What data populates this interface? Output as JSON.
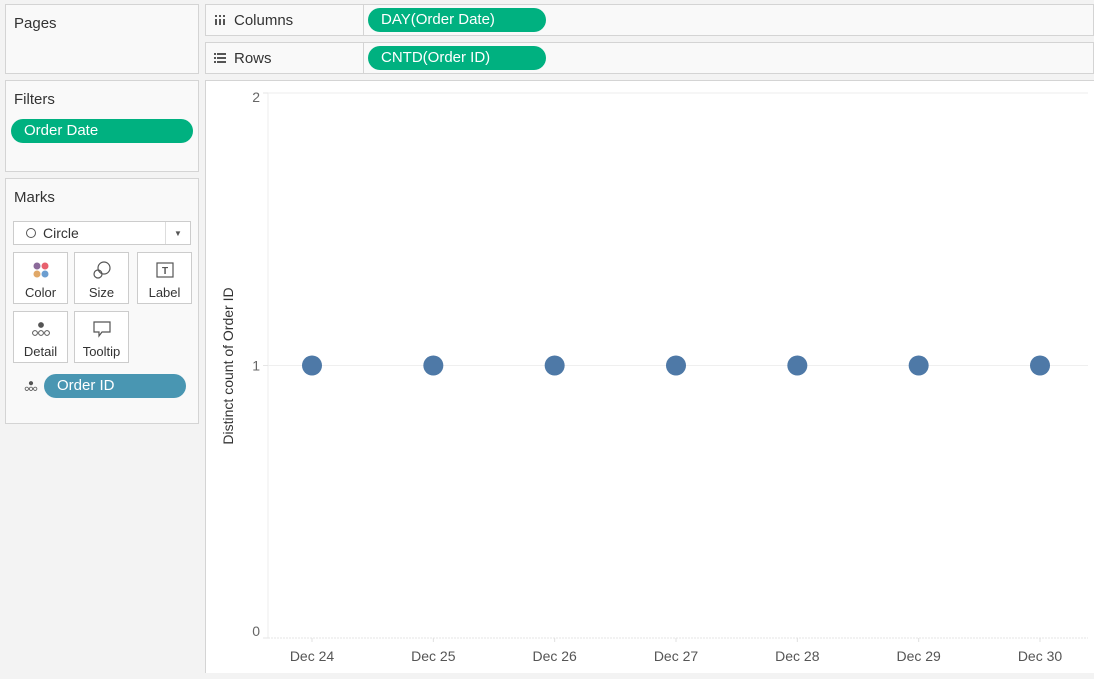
{
  "pages": {
    "title": "Pages"
  },
  "filters": {
    "title": "Filters",
    "pills": [
      "Order Date"
    ]
  },
  "marks": {
    "title": "Marks",
    "mark_type": "Circle",
    "buttons": {
      "color": "Color",
      "size": "Size",
      "label": "Label",
      "detail": "Detail",
      "tooltip": "Tooltip"
    },
    "fields": [
      {
        "name": "Order ID",
        "encoding": "detail-icon"
      }
    ]
  },
  "shelves": {
    "columns": {
      "label": "Columns",
      "icon": "columns-icon",
      "pill": "DAY(Order Date)"
    },
    "rows": {
      "label": "Rows",
      "icon": "rows-icon",
      "pill": "CNTD(Order ID)"
    }
  },
  "colors": {
    "pill_green": "#00b180",
    "pill_blue": "#4996b2",
    "mark": "#4e79a7"
  },
  "chart_data": {
    "type": "scatter",
    "title": "",
    "xlabel": "",
    "ylabel": "Distinct count of Order ID",
    "categories": [
      "Dec 24",
      "Dec 25",
      "Dec 26",
      "Dec 27",
      "Dec 28",
      "Dec 29",
      "Dec 30"
    ],
    "values": [
      1,
      1,
      1,
      1,
      1,
      1,
      1
    ],
    "ylim": [
      0,
      2
    ],
    "yticks": [
      0,
      1,
      2
    ],
    "grid": true,
    "legend": "none"
  }
}
